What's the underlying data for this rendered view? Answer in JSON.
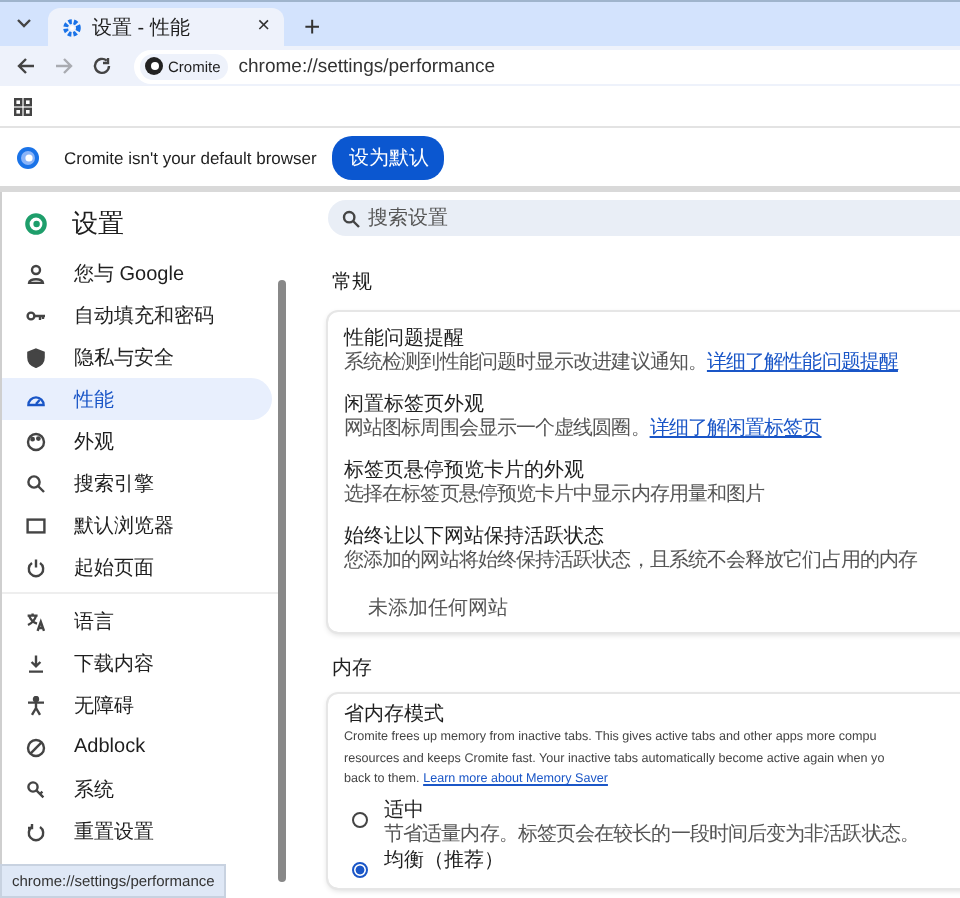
{
  "tabs": [
    {
      "title": "设置 - 性能",
      "selected": true,
      "close": "×"
    }
  ],
  "new_tab": "+",
  "toolbar": {
    "back_disabled": false,
    "forward_disabled": true,
    "chip": "Cromite",
    "url": "chrome://settings/performance"
  },
  "infobar": {
    "message": "Cromite isn't your default browser",
    "button": "设为默认"
  },
  "settings": {
    "title": "设置",
    "search": {
      "placeholder": "搜索设置"
    },
    "nav_groups": [
      [
        {
          "label": "您与 Google",
          "selected": false
        },
        {
          "label": "自动填充和密码",
          "selected": false
        },
        {
          "label": "隐私与安全",
          "selected": false
        },
        {
          "label": "性能",
          "selected": true
        },
        {
          "label": "外观",
          "selected": false
        },
        {
          "label": "搜索引擎",
          "selected": false
        },
        {
          "label": "默认浏览器",
          "selected": false
        },
        {
          "label": "起始页面",
          "selected": false
        }
      ],
      [
        {
          "label": "语言",
          "selected": false
        },
        {
          "label": "下载内容",
          "selected": false
        },
        {
          "label": "无障碍",
          "selected": false
        },
        {
          "label": "Adblock",
          "selected": false
        },
        {
          "label": "系统",
          "selected": false
        },
        {
          "label": "重置设置",
          "selected": false
        }
      ]
    ],
    "sections": [
      {
        "heading": "常规",
        "items": [
          {
            "kind": "setting",
            "title": "性能问题提醒",
            "description": "系统检测到性能问题时显示改进建议通知。",
            "link": "详细了解性能问题提醒"
          },
          {
            "kind": "setting",
            "title": "闲置标签页外观",
            "description": "网站图标周围会显示一个虚线圆圈。",
            "link": "详细了解闲置标签页"
          },
          {
            "kind": "setting",
            "title": "标签页悬停预览卡片的外观",
            "description": "选择在标签页悬停预览卡片中显示内存用量和图片"
          },
          {
            "kind": "setting",
            "title": "始终让以下网站保持活跃状态",
            "description": "您添加的网站将始终保持活跃状态，且系统不会释放它们占用的内存"
          },
          {
            "kind": "empty",
            "text": "未添加任何网站"
          }
        ]
      },
      {
        "heading": "内存",
        "items": [
          {
            "kind": "paragraph",
            "title": "省内存模式",
            "lines": [
              "Cromite frees up memory from inactive tabs. This gives active tabs and other apps more compu",
              "resources and keeps Cromite fast. Your inactive tabs automatically become active again when yo",
              "back to them."
            ],
            "link": "Learn more about Memory Saver"
          },
          {
            "kind": "radio",
            "title": "适中",
            "description": "节省适量内存。标签页会在较长的一段时间后变为非活跃状态。",
            "selected": false
          },
          {
            "kind": "radio",
            "title": "均衡（推荐）",
            "selected": true
          }
        ]
      }
    ]
  },
  "status_bubble": "chrome://settings/performance"
}
